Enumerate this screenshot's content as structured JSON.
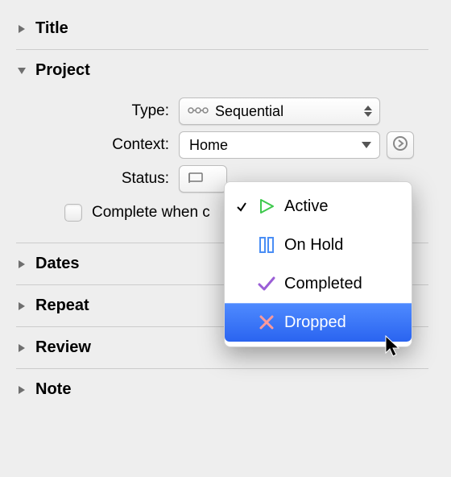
{
  "sections": {
    "title": {
      "label": "Title",
      "expanded": false
    },
    "project": {
      "label": "Project",
      "expanded": true
    },
    "dates": {
      "label": "Dates",
      "expanded": false
    },
    "repeat": {
      "label": "Repeat",
      "expanded": false
    },
    "review": {
      "label": "Review",
      "expanded": false
    },
    "note": {
      "label": "Note",
      "expanded": false
    }
  },
  "project": {
    "type_label": "Type:",
    "type_value": "Sequential",
    "type_icon": "sequential-icon",
    "context_label": "Context:",
    "context_value": "Home",
    "status_label": "Status:",
    "status_icon": "flag-icon",
    "complete_checkbox_label": "Complete when c",
    "complete_checked": false
  },
  "status_menu": {
    "current_index": 0,
    "hover_index": 3,
    "items": [
      {
        "label": "Active",
        "icon": "play-icon",
        "color": "#3ec94d"
      },
      {
        "label": "On Hold",
        "icon": "pause-icon",
        "color": "#4a8ef5"
      },
      {
        "label": "Completed",
        "icon": "check-icon",
        "color": "#9a5ed6"
      },
      {
        "label": "Dropped",
        "icon": "cross-icon",
        "color": "#ff6d6d"
      }
    ]
  }
}
